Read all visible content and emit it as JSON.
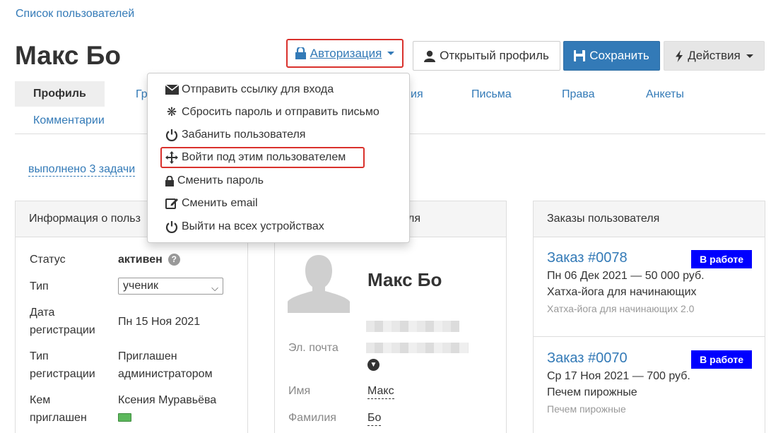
{
  "breadcrumb": "Список пользователей",
  "page_title": "Макс Бо",
  "toolbar": {
    "auth_label": "Авторизация",
    "profile_label": "Открытый профиль",
    "save_label": "Сохранить",
    "actions_label": "Действия"
  },
  "dropdown": {
    "items": [
      {
        "label": "Отправить ссылку для входа",
        "icon": "envelope-icon"
      },
      {
        "label": "Сбросить пароль и отправить письмо",
        "icon": "asterisk-icon"
      },
      {
        "label": "Забанить пользователя",
        "icon": "power-icon"
      },
      {
        "label": "Войти под этим пользователем",
        "icon": "move-icon"
      },
      {
        "label": "Сменить пароль",
        "icon": "lock-icon"
      },
      {
        "label": "Сменить email",
        "icon": "edit-icon"
      },
      {
        "label": "Выйти на всех устройствах",
        "icon": "power-icon"
      }
    ]
  },
  "tabs": {
    "profile": "Профиль",
    "groups_partial": "Гр",
    "history_partial": "ия",
    "letters": "Письма",
    "rights": "Права",
    "forms": "Анкеты",
    "comments": "Комментарии"
  },
  "tasks_link": "выполнено 3 задачи",
  "info_panel": {
    "title": "Информация о польз",
    "status_label": "Статус",
    "status_value": "активен",
    "help_glyph": "?",
    "type_label": "Тип",
    "type_value": "ученик",
    "reg_date_label_1": "Дата",
    "reg_date_label_2": "регистрации",
    "reg_date_value": "Пн 15 Ноя 2021",
    "reg_type_label_1": "Тип",
    "reg_type_label_2": "регистрации",
    "reg_type_value_1": "Приглашен",
    "reg_type_value_2": "администратором",
    "invited_label_1": "Кем",
    "invited_label_2": "приглашен",
    "invited_value": "Ксения Муравьёва"
  },
  "user_panel": {
    "title_partial": "ля",
    "name": "Макс Бо",
    "email_label": "Эл. почта",
    "first_name_label": "Имя",
    "first_name_value": "Макс",
    "last_name_label": "Фамилия",
    "last_name_value": "Бо"
  },
  "orders_panel": {
    "title": "Заказы пользователя",
    "orders": [
      {
        "link": "Заказ #0078",
        "badge": "В работе",
        "line": "Пн 06 Дек 2021 — 50 000 руб.",
        "product": "Хатха-йога для начинающих",
        "sub": "Хатха-йога для начинающих 2.0"
      },
      {
        "link": "Заказ #0070",
        "badge": "В работе",
        "line": "Ср 17 Ноя 2021 — 700 руб.",
        "product": "Печем пирожные",
        "sub": "Печем пирожные"
      }
    ]
  },
  "colors": {
    "link": "#337ab7",
    "primary": "#337ab7",
    "highlight_border": "#d9312c",
    "badge_bg": "#0000ff"
  }
}
